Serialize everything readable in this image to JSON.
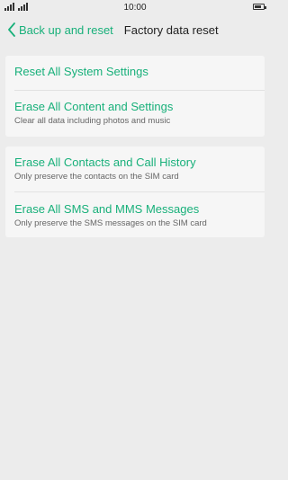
{
  "status_bar": {
    "time": "10:00",
    "battery_level": 0.8,
    "icons": [
      "signal-icon",
      "signal-icon",
      "battery-icon"
    ]
  },
  "header": {
    "back_label": "Back up and reset",
    "back_icon": "chevron-left-icon",
    "title": "Factory data reset"
  },
  "accent_color": "#18b07a",
  "groups": [
    {
      "items": [
        {
          "label": "Reset All System Settings",
          "subtitle": ""
        },
        {
          "label": "Erase All Content and Settings",
          "subtitle": "Clear all data including photos and music"
        }
      ]
    },
    {
      "items": [
        {
          "label": "Erase All Contacts and Call History",
          "subtitle": "Only preserve the contacts on the SIM card"
        },
        {
          "label": "Erase All SMS and MMS Messages",
          "subtitle": "Only preserve the SMS messages on the SIM card"
        }
      ]
    }
  ]
}
